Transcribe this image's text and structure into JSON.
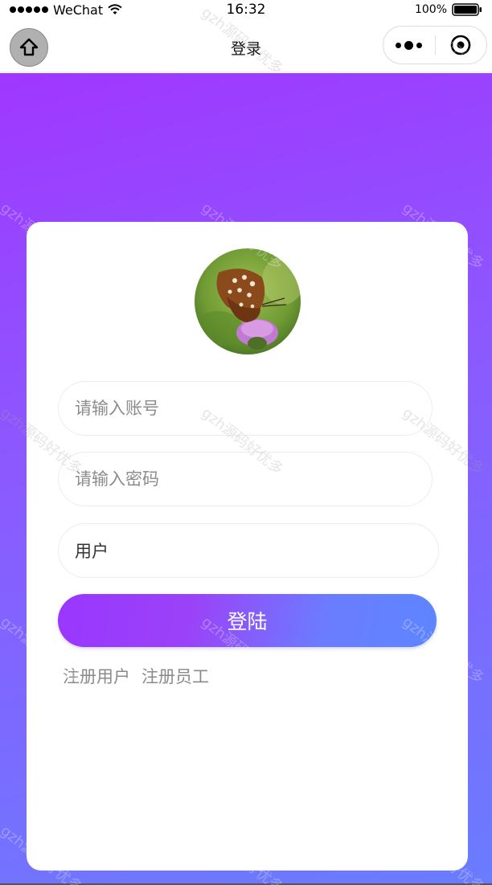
{
  "status_bar": {
    "carrier": "WeChat",
    "time": "16:32",
    "battery": "100%"
  },
  "nav": {
    "title": "登录"
  },
  "form": {
    "account_placeholder": "请输入账号",
    "password_placeholder": "请输入密码",
    "role_value": "用户",
    "login_label": "登陆"
  },
  "links": {
    "register_user": "注册用户",
    "register_staff": "注册员工"
  },
  "watermark": "gzh源码好优多",
  "colors": {
    "gradient_top": "#a037ff",
    "gradient_bottom": "#6a7cff",
    "button_start": "#9a37ff",
    "button_end": "#5d86ff"
  }
}
